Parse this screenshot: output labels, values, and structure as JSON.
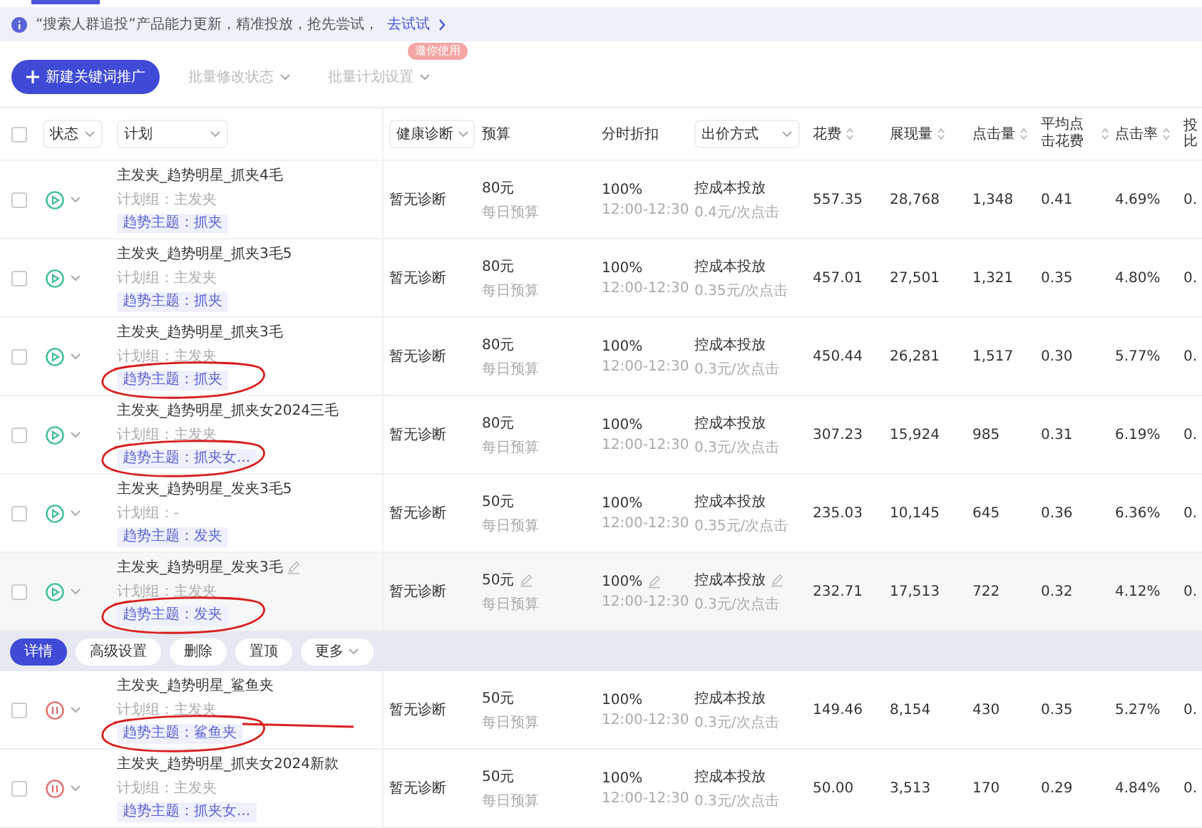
{
  "banner": {
    "text": "“搜索人群追投”产品能力更新，精准投放，抢先尝试，",
    "link": "去试试"
  },
  "toolbar": {
    "primary": "新建关键词推广",
    "buttons": [
      {
        "label": "批量修改状态",
        "disabled": true
      },
      {
        "label": "批量计划设置",
        "disabled": true,
        "badge": "邀你使用"
      }
    ]
  },
  "table": {
    "select_all_checked": false,
    "columns": [
      {
        "label": "状态",
        "kind": "dropdown"
      },
      {
        "label": "计划",
        "kind": "dropdown"
      },
      {
        "label": "健康诊断",
        "kind": "dropdown"
      },
      {
        "label": "预算",
        "kind": "plain"
      },
      {
        "label": "分时折扣",
        "kind": "plain"
      },
      {
        "label": "出价方式",
        "kind": "dropdown"
      },
      {
        "label": "花费",
        "kind": "sort"
      },
      {
        "label": "展现量",
        "kind": "sort"
      },
      {
        "label": "点击量",
        "kind": "sort"
      },
      {
        "label": "平均点击花费",
        "kind": "sort"
      },
      {
        "label": "点击率",
        "kind": "sort"
      },
      {
        "label": "投比",
        "kind": "clipped"
      }
    ],
    "rows": [
      {
        "checked": false,
        "paused": false,
        "hovered": false,
        "circled": false,
        "name": "主发夹_趋势明星_抓夹4毛",
        "group": "计划组：主发夹",
        "tag": "趋势主题：抓夹",
        "health": "暂无诊断",
        "budget": "80元",
        "budget_note": "每日预算",
        "discount": "100%",
        "time": "12:00-12:30",
        "bid_type": "控成本投放",
        "bid": "0.4元/次点击",
        "cost": "557.35",
        "impressions": "28,768",
        "clicks": "1,348",
        "avg_cost": "0.41",
        "ctr": "4.69%",
        "column_12": "0."
      },
      {
        "checked": false,
        "paused": false,
        "hovered": false,
        "circled": false,
        "name": "主发夹_趋势明星_抓夹3毛5",
        "group": "计划组：主发夹",
        "tag": "趋势主题：抓夹",
        "health": "暂无诊断",
        "budget": "80元",
        "budget_note": "每日预算",
        "discount": "100%",
        "time": "12:00-12:30",
        "bid_type": "控成本投放",
        "bid": "0.35元/次点击",
        "cost": "457.01",
        "impressions": "27,501",
        "clicks": "1,321",
        "avg_cost": "0.35",
        "ctr": "4.80%",
        "column_12": "0."
      },
      {
        "checked": false,
        "paused": false,
        "hovered": false,
        "circled": true,
        "name": "主发夹_趋势明星_抓夹3毛",
        "group": "计划组：主发夹",
        "tag": "趋势主题：抓夹",
        "health": "暂无诊断",
        "budget": "80元",
        "budget_note": "每日预算",
        "discount": "100%",
        "time": "12:00-12:30",
        "bid_type": "控成本投放",
        "bid": "0.3元/次点击",
        "cost": "450.44",
        "impressions": "26,281",
        "clicks": "1,517",
        "avg_cost": "0.30",
        "ctr": "5.77%",
        "column_12": "0."
      },
      {
        "checked": false,
        "paused": false,
        "hovered": false,
        "circled": true,
        "name": "主发夹_趋势明星_抓夹女2024三毛",
        "group": "计划组：主发夹",
        "tag": "趋势主题：抓夹女...",
        "health": "暂无诊断",
        "budget": "80元",
        "budget_note": "每日预算",
        "discount": "100%",
        "time": "12:00-12:30",
        "bid_type": "控成本投放",
        "bid": "0.3元/次点击",
        "cost": "307.23",
        "impressions": "15,924",
        "clicks": "985",
        "avg_cost": "0.31",
        "ctr": "6.19%",
        "column_12": "0."
      },
      {
        "checked": false,
        "paused": false,
        "hovered": false,
        "circled": false,
        "name": "主发夹_趋势明星_发夹3毛5",
        "group": "计划组：-",
        "tag": "趋势主题：发夹",
        "health": "暂无诊断",
        "budget": "50元",
        "budget_note": "每日预算",
        "discount": "100%",
        "time": "12:00-12:30",
        "bid_type": "控成本投放",
        "bid": "0.35元/次点击",
        "cost": "235.03",
        "impressions": "10,145",
        "clicks": "645",
        "avg_cost": "0.36",
        "ctr": "6.36%",
        "column_12": "0."
      },
      {
        "checked": false,
        "paused": false,
        "hovered": true,
        "circled": true,
        "name": "主发夹_趋势明星_发夹3毛",
        "group": "计划组：主发夹",
        "tag": "趋势主题：发夹",
        "health": "暂无诊断",
        "budget": "50元",
        "budget_note": "每日预算",
        "discount": "100%",
        "time": "12:00-12:30",
        "bid_type": "控成本投放",
        "bid": "0.3元/次点击",
        "cost": "232.71",
        "impressions": "17,513",
        "clicks": "722",
        "avg_cost": "0.32",
        "ctr": "4.12%",
        "column_12": "0.",
        "actions": [
          {
            "label": "详情",
            "primary": true
          },
          {
            "label": "高级设置",
            "primary": false
          },
          {
            "label": "删除",
            "primary": false
          },
          {
            "label": "置顶",
            "primary": false
          },
          {
            "label": "更多",
            "primary": false,
            "menu": true
          }
        ]
      },
      {
        "checked": false,
        "paused": true,
        "hovered": false,
        "circled": true,
        "name": "主发夹_趋势明星_鲨鱼夹",
        "group": "计划组：主发夹",
        "tag": "趋势主题：鲨鱼夹",
        "health": "暂无诊断",
        "budget": "50元",
        "budget_note": "每日预算",
        "discount": "100%",
        "time": "12:00-12:30",
        "bid_type": "控成本投放",
        "bid": "0.3元/次点击",
        "cost": "149.46",
        "impressions": "8,154",
        "clicks": "430",
        "avg_cost": "0.35",
        "ctr": "5.27%",
        "column_12": "0."
      },
      {
        "checked": false,
        "paused": true,
        "hovered": false,
        "circled": false,
        "name": "主发夹_趋势明星_抓夹女2024新款",
        "group": "计划组：主发夹",
        "tag": "趋势主题：抓夹女...",
        "health": "暂无诊断",
        "budget": "50元",
        "budget_note": "每日预算",
        "discount": "100%",
        "time": "12:00-12:30",
        "bid_type": "控成本投放",
        "bid": "0.3元/次点击",
        "cost": "50.00",
        "impressions": "3,513",
        "clicks": "170",
        "avg_cost": "0.29",
        "ctr": "4.84%",
        "column_12": "0."
      }
    ]
  }
}
